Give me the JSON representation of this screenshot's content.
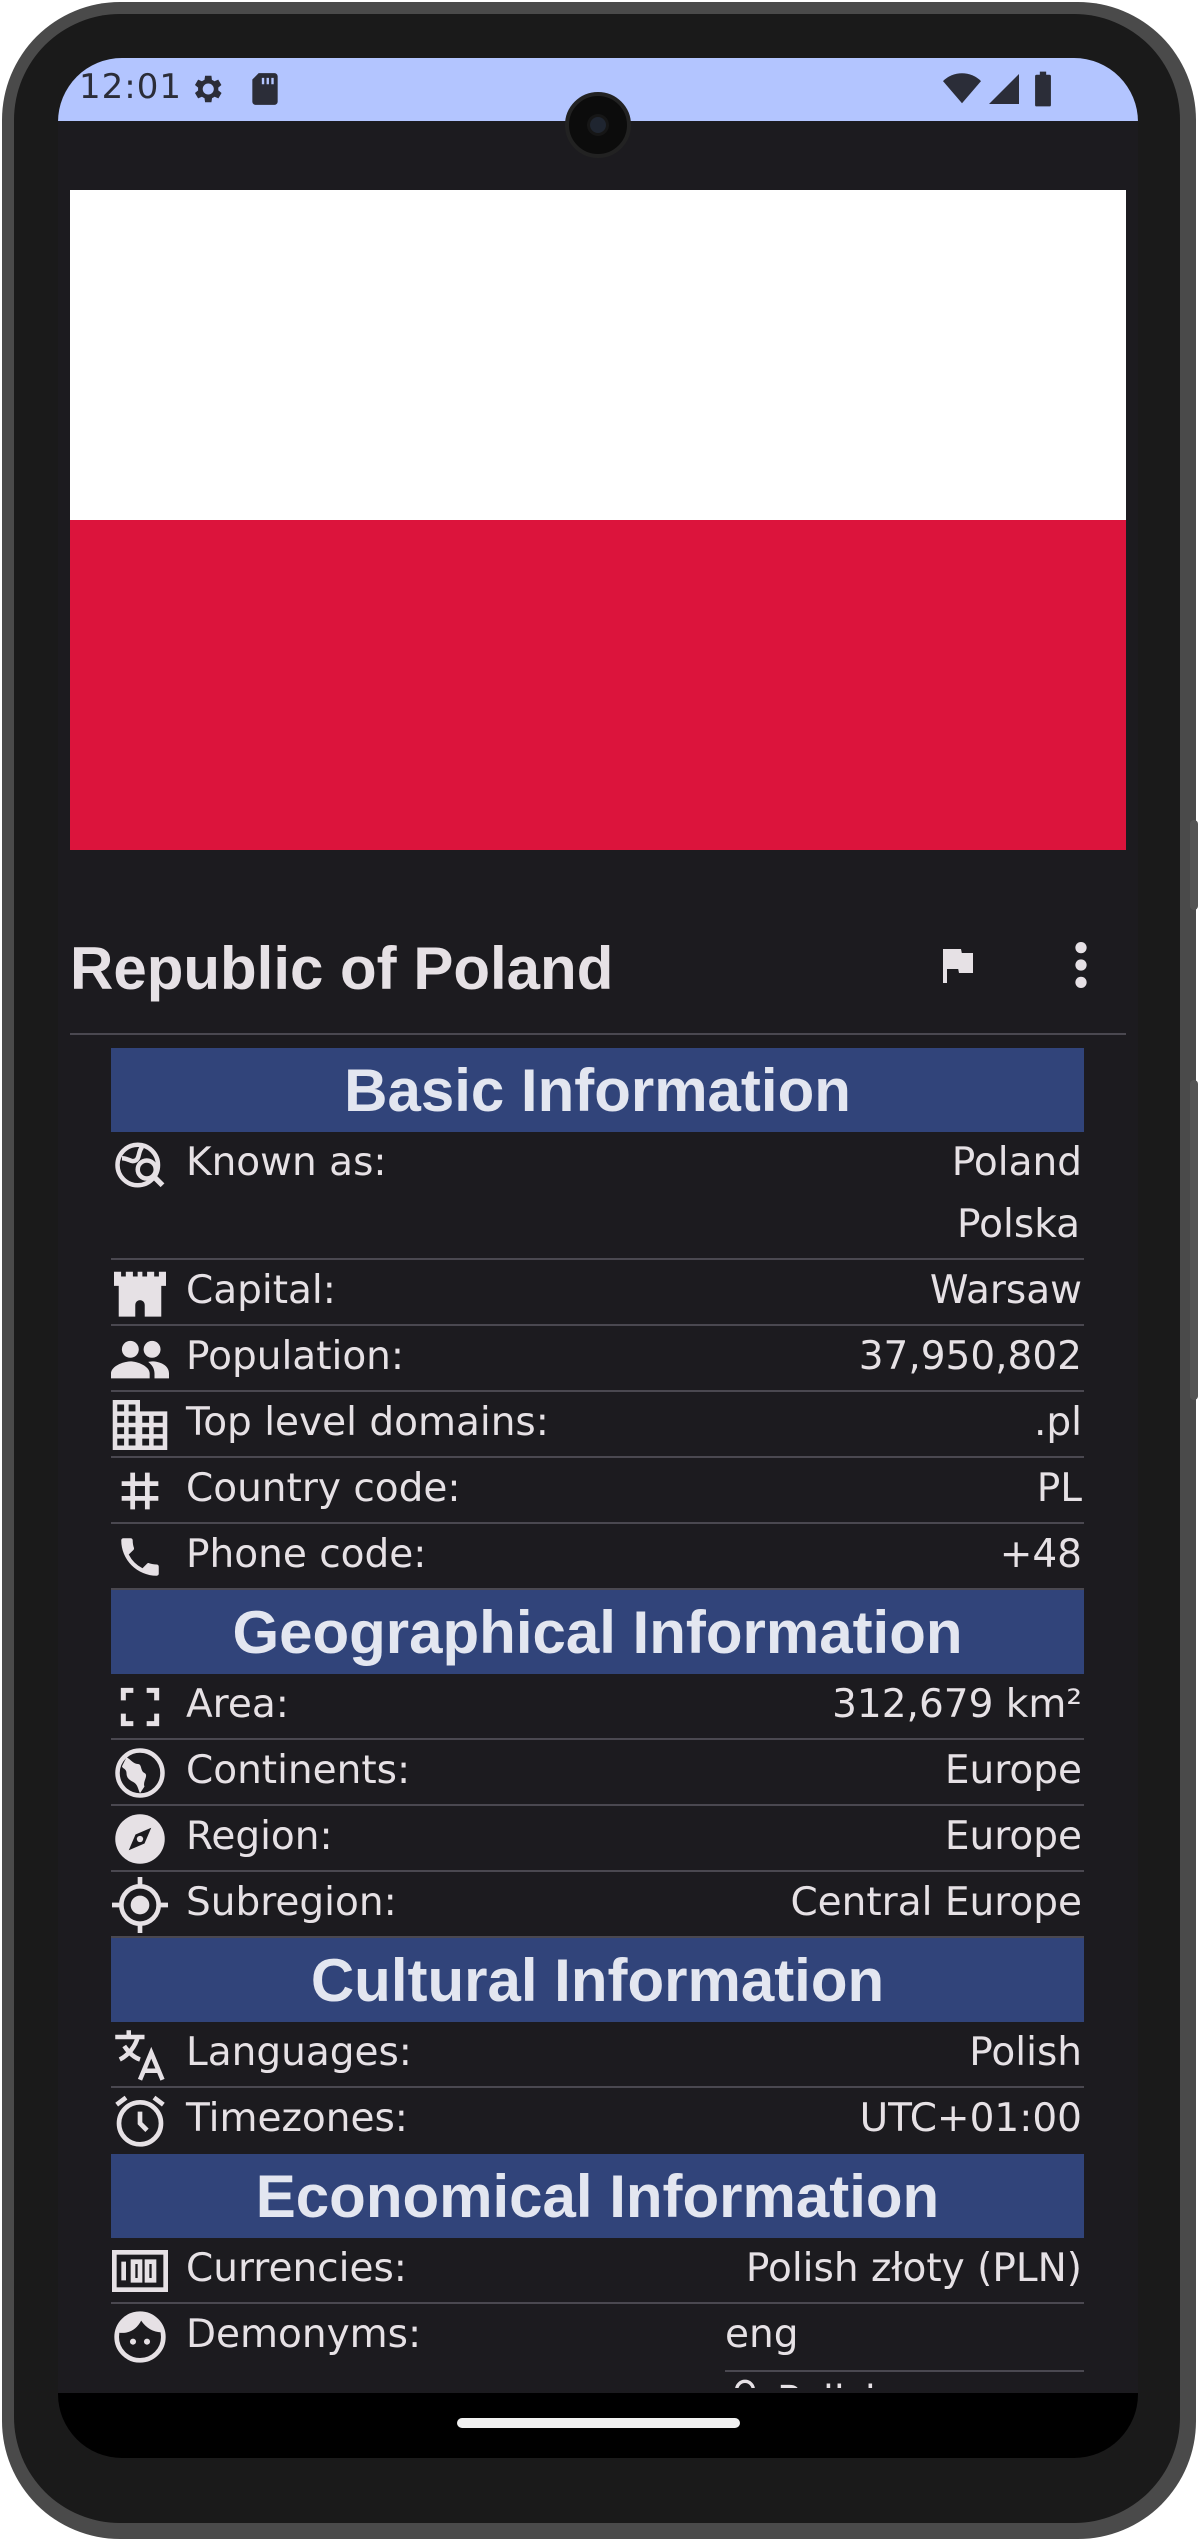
{
  "status_bar": {
    "time": "12:01",
    "left_icons": [
      "gear-icon",
      "sd-card-icon"
    ],
    "right_icons": [
      "wifi-icon",
      "signal-icon",
      "battery-icon"
    ]
  },
  "flag": {
    "top_color": "#ffffff",
    "bottom_color": "#dc143c"
  },
  "header": {
    "title": "Republic of Poland",
    "actions": [
      "flag-icon",
      "more-vert-icon"
    ]
  },
  "sections": {
    "basic": {
      "title": "Basic Information",
      "known_as": {
        "label": "Known as:",
        "values": [
          "Poland",
          "Polska"
        ]
      },
      "capital": {
        "label": "Capital:",
        "value": "Warsaw"
      },
      "population": {
        "label": "Population:",
        "value": "37,950,802"
      },
      "tld": {
        "label": "Top level domains:",
        "value": ".pl"
      },
      "country_code": {
        "label": "Country code:",
        "value": "PL"
      },
      "phone_code": {
        "label": "Phone code:",
        "value": "+48"
      }
    },
    "geo": {
      "title": "Geographical Information",
      "area": {
        "label": "Area:",
        "value": "312,679 km²"
      },
      "continents": {
        "label": "Continents:",
        "value": "Europe"
      },
      "region": {
        "label": "Region:",
        "value": "Europe"
      },
      "subregion": {
        "label": "Subregion:",
        "value": "Central Europe"
      }
    },
    "cultural": {
      "title": "Cultural Information",
      "languages": {
        "label": "Languages:",
        "value": "Polish"
      },
      "timezones": {
        "label": "Timezones:",
        "value": "UTC+01:00"
      }
    },
    "economic": {
      "title": "Economical Information",
      "currencies": {
        "label": "Currencies:",
        "value": "Polish złoty (PLN)"
      },
      "demonyms": {
        "label": "Demonyms:",
        "lang": "eng",
        "value": "Polish"
      }
    }
  },
  "colors": {
    "section_header": "#31447a",
    "status_bar": "#b3c5ff",
    "background": "#1c1b1f"
  }
}
